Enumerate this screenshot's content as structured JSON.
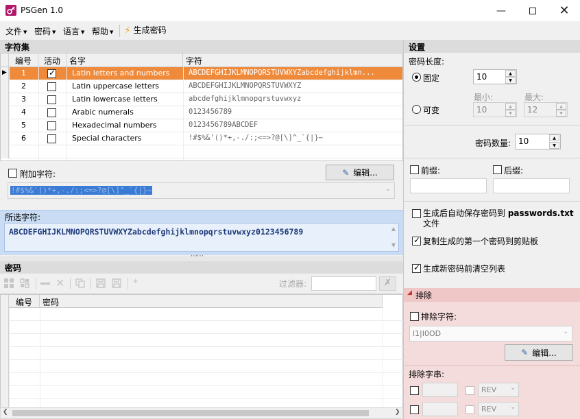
{
  "window": {
    "title": "PSGen 1.0"
  },
  "menu": {
    "file": "文件",
    "password": "密码",
    "language": "语言",
    "help": "帮助",
    "generate": "生成密码"
  },
  "charset": {
    "section_title": "字符集",
    "columns": {
      "num": "编号",
      "active": "活动",
      "name": "名字",
      "chars": "字符"
    },
    "rows": [
      {
        "num": "1",
        "active": true,
        "name": "Latin letters and numbers",
        "chars": "ABCDEFGHIJKLMNOPQRSTUVWXYZabcdefghijklmn..."
      },
      {
        "num": "2",
        "active": false,
        "name": "Latin uppercase letters",
        "chars": "ABCDEFGHIJKLMNOPQRSTUVWXYZ"
      },
      {
        "num": "3",
        "active": false,
        "name": "Latin lowercase letters",
        "chars": "abcdefghijklmnopqrstuvwxyz"
      },
      {
        "num": "4",
        "active": false,
        "name": "Arabic numerals",
        "chars": "0123456789"
      },
      {
        "num": "5",
        "active": false,
        "name": "Hexadecimal numbers",
        "chars": "0123456789ABCDEF"
      },
      {
        "num": "6",
        "active": false,
        "name": "Special characters",
        "chars": "!#$%&'()*+,-./:;<=>?@[\\]^_`{|}~"
      }
    ],
    "extra_label": "附加字符:",
    "edit_button": "编辑...",
    "extra_value": "!#$%&'()*+,-./:;<=>?@[\\]^_`{|}~",
    "selected_label": "所选字符:",
    "selected_value": "ABCDEFGHIJKLMNOPQRSTUVWXYZabcdefghijklmnopqrstuvwxyz0123456789"
  },
  "passwords": {
    "section_title": "密码",
    "filter_label": "过滤器:",
    "columns": {
      "num": "编号",
      "password": "密码"
    }
  },
  "settings": {
    "section_title": "设置",
    "length_label": "密码长度:",
    "fixed_label": "固定",
    "fixed_value": "10",
    "variable_label": "可变",
    "min_label": "最小:",
    "max_label": "最大:",
    "min_value": "10",
    "max_value": "12",
    "count_label": "密码数量:",
    "count_value": "10",
    "prefix_label": "前缀:",
    "suffix_label": "后缀:",
    "autosave_label": "生成后自动保存密码到",
    "autosave_file": "passwords.txt",
    "autosave_suffix": "文件",
    "copy_label": "复制生成的第一个密码到剪贴板",
    "clear_label": "生成新密码前清空列表"
  },
  "exclude": {
    "section_title": "排除",
    "chars_label": "排除字符:",
    "chars_value": "l1|I0OD",
    "edit_button": "编辑...",
    "strings_label": "排除字串:",
    "rev_label": "REV"
  }
}
